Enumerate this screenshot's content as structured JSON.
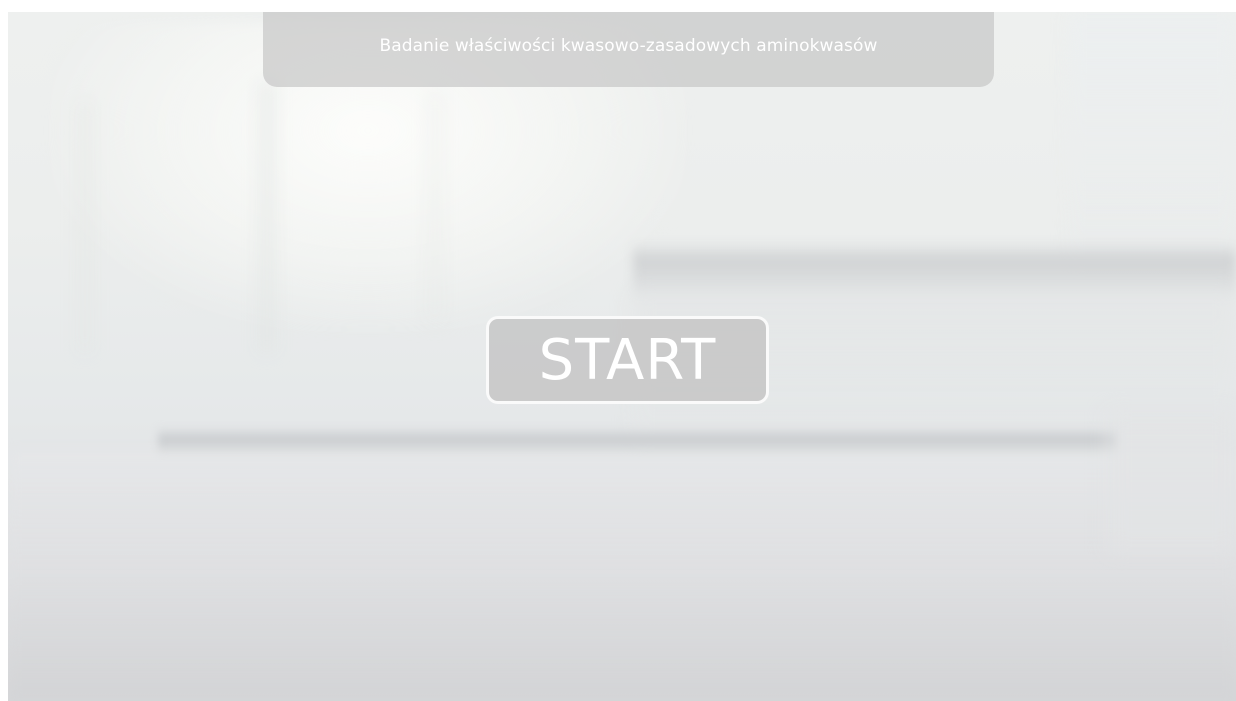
{
  "app": {
    "title": "Badanie właściwości kwasowo-zasadowych aminokwasów"
  },
  "start_button": {
    "label": "START"
  },
  "colors": {
    "title_bar_bg": "#c8c8c8",
    "button_bg": "#c4c4c4",
    "button_border": "#ffffff",
    "text": "#ffffff"
  }
}
